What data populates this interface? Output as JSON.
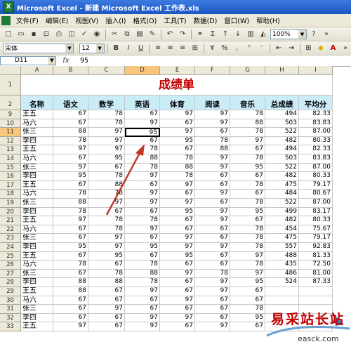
{
  "window": {
    "title": "Microsoft Excel - 新建 Microsoft Excel 工作表.xls",
    "app_icon": "excel-icon"
  },
  "menu": [
    "文件(F)",
    "编辑(E)",
    "视图(V)",
    "插入(I)",
    "格式(O)",
    "工具(T)",
    "数据(D)",
    "窗口(W)",
    "帮助(H)"
  ],
  "toolbar": {
    "zoom": "100%",
    "font": "宋体",
    "size": "12",
    "bold": "B",
    "italic": "I",
    "underline": "U"
  },
  "formula_bar": {
    "name_box": "D11",
    "fx": "fx",
    "value": "95"
  },
  "columns": [
    "A",
    "B",
    "C",
    "D",
    "E",
    "F",
    "G",
    "H",
    "I"
  ],
  "sheet_title": "成绩单",
  "headers": [
    "名称",
    "语文",
    "数学",
    "英语",
    "体育",
    "阅读",
    "音乐",
    "总成绩",
    "平均分"
  ],
  "rows": [
    {
      "row": "9",
      "cells": [
        "王五",
        "67",
        "78",
        "67",
        "97",
        "97",
        "78",
        "494",
        "82.33"
      ]
    },
    {
      "row": "10",
      "cells": [
        "马六",
        "67",
        "78",
        "97",
        "67",
        "97",
        "88",
        "503",
        "83.83"
      ]
    },
    {
      "row": "11",
      "cells": [
        "张三",
        "88",
        "97",
        "95",
        "97",
        "67",
        "78",
        "522",
        "87.00"
      ]
    },
    {
      "row": "12",
      "cells": [
        "李四",
        "78",
        "97",
        "67",
        "95",
        "78",
        "97",
        "482",
        "80.33"
      ]
    },
    {
      "row": "13",
      "cells": [
        "王五",
        "97",
        "97",
        "78",
        "67",
        "88",
        "67",
        "494",
        "82.33"
      ]
    },
    {
      "row": "14",
      "cells": [
        "马六",
        "67",
        "95",
        "88",
        "78",
        "97",
        "78",
        "503",
        "83.83"
      ]
    },
    {
      "row": "15",
      "cells": [
        "张三",
        "97",
        "67",
        "78",
        "88",
        "97",
        "95",
        "522",
        "87.00"
      ]
    },
    {
      "row": "16",
      "cells": [
        "李四",
        "95",
        "78",
        "97",
        "78",
        "67",
        "67",
        "482",
        "80.33"
      ]
    },
    {
      "row": "17",
      "cells": [
        "王五",
        "67",
        "88",
        "67",
        "97",
        "67",
        "78",
        "475",
        "79.17"
      ]
    },
    {
      "row": "18",
      "cells": [
        "马六",
        "78",
        "78",
        "97",
        "67",
        "97",
        "67",
        "484",
        "80.67"
      ]
    },
    {
      "row": "19",
      "cells": [
        "张三",
        "88",
        "97",
        "97",
        "97",
        "67",
        "78",
        "522",
        "87.00"
      ]
    },
    {
      "row": "20",
      "cells": [
        "李四",
        "78",
        "67",
        "67",
        "95",
        "97",
        "95",
        "499",
        "83.17"
      ]
    },
    {
      "row": "21",
      "cells": [
        "王五",
        "97",
        "78",
        "78",
        "67",
        "97",
        "67",
        "482",
        "80.33"
      ]
    },
    {
      "row": "22",
      "cells": [
        "马六",
        "67",
        "78",
        "97",
        "67",
        "67",
        "78",
        "454",
        "75.67"
      ]
    },
    {
      "row": "23",
      "cells": [
        "张三",
        "67",
        "97",
        "67",
        "97",
        "67",
        "78",
        "475",
        "79.17"
      ]
    },
    {
      "row": "24",
      "cells": [
        "李四",
        "95",
        "97",
        "95",
        "97",
        "97",
        "78",
        "557",
        "92.83"
      ]
    },
    {
      "row": "25",
      "cells": [
        "王五",
        "67",
        "95",
        "67",
        "95",
        "67",
        "97",
        "488",
        "81.33"
      ]
    },
    {
      "row": "26",
      "cells": [
        "马六",
        "78",
        "67",
        "78",
        "67",
        "67",
        "78",
        "435",
        "72.50"
      ]
    },
    {
      "row": "27",
      "cells": [
        "张三",
        "67",
        "78",
        "88",
        "97",
        "78",
        "97",
        "486",
        "81.00"
      ]
    },
    {
      "row": "28",
      "cells": [
        "李四",
        "88",
        "88",
        "78",
        "67",
        "97",
        "95",
        "524",
        "87.33"
      ]
    },
    {
      "row": "29",
      "cells": [
        "王五",
        "88",
        "67",
        "97",
        "67",
        "97",
        "67",
        "",
        ""
      ]
    },
    {
      "row": "30",
      "cells": [
        "马六",
        "67",
        "67",
        "67",
        "97",
        "67",
        "67",
        "",
        ""
      ]
    },
    {
      "row": "31",
      "cells": [
        "张三",
        "67",
        "97",
        "67",
        "67",
        "67",
        "78",
        "",
        ""
      ]
    },
    {
      "row": "32",
      "cells": [
        "李四",
        "67",
        "67",
        "97",
        "97",
        "67",
        "95",
        "",
        ""
      ]
    },
    {
      "row": "33",
      "cells": [
        "王五",
        "97",
        "67",
        "97",
        "67",
        "97",
        "67",
        "",
        ""
      ]
    }
  ],
  "watermark": {
    "text": "易采站长站",
    "url": "easck.com"
  },
  "colors": {
    "title": "#c00000",
    "header_row_bg": "#c9ecf7",
    "arrow": "#c0392b",
    "selected_header": "#f9c57a"
  }
}
